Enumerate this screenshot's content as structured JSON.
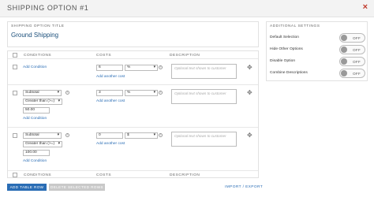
{
  "header": {
    "title": "SHIPPING OPTION #1",
    "close_symbol": "×"
  },
  "shipping_option": {
    "caption": "SHIPPING OPTION TITLE",
    "value": "Ground Shipping"
  },
  "additional_settings": {
    "caption": "ADDITIONAL SETTINGS",
    "items": [
      {
        "label": "Default Selection",
        "state": "OFF"
      },
      {
        "label": "Hide Other Options",
        "state": "OFF"
      },
      {
        "label": "Disable Option",
        "state": "OFF"
      },
      {
        "label": "Combine Descriptions",
        "state": "OFF"
      }
    ]
  },
  "table": {
    "columns": [
      "CONDITIONS",
      "COSTS",
      "DESCRIPTION"
    ],
    "rows": [
      {
        "add_condition": "Add Condition",
        "cost_value": "6",
        "cost_unit": "%",
        "add_cost": "Add another cost",
        "description_placeholder": "Optional text shown to customer"
      },
      {
        "condition_field": "Subtotal",
        "condition_operator": "Greater than (>=)",
        "condition_value": "50.00",
        "add_condition": "Add Condition",
        "cost_value": "3",
        "cost_unit": "%",
        "add_cost": "Add another cost",
        "description_placeholder": "Optional text shown to customer"
      },
      {
        "condition_field": "Subtotal",
        "condition_operator": "Greater than (>=)",
        "condition_value": "100.00",
        "add_condition": "Add Condition",
        "cost_value": "0",
        "cost_unit": "$",
        "add_cost": "Add another cost",
        "description_placeholder": "Optional text shown to customer"
      }
    ]
  },
  "footer": {
    "add_row": "ADD TABLE ROW",
    "delete_rows": "DELETE SELECTED ROWS",
    "import_export": "IMPORT / EXPORT"
  },
  "colors": {
    "accent": "#2a6db5",
    "close": "#c0392b",
    "title": "#1a4e7a"
  }
}
